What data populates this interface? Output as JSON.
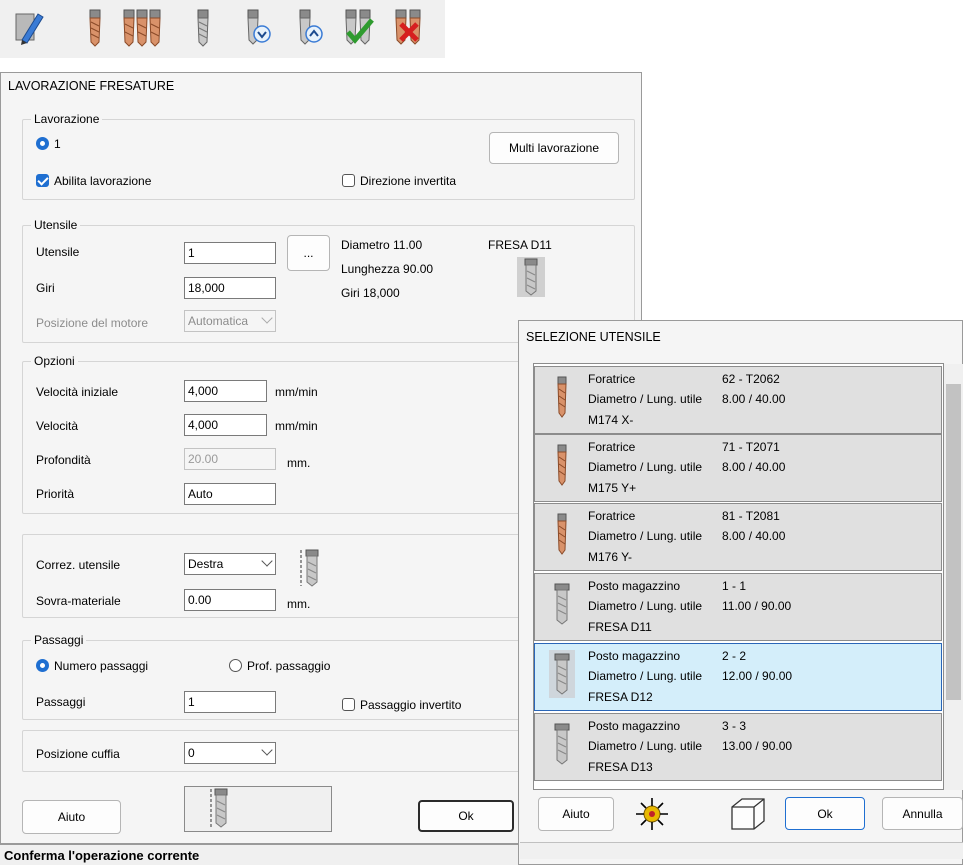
{
  "toolbar": {
    "buttons": [
      {
        "icon": "edit-pencil-icon"
      },
      {
        "icon": "tool-single-icon"
      },
      {
        "icon": "tool-multiple-icon"
      },
      {
        "icon": "tool-gray-icon"
      },
      {
        "icon": "tool-move-down-icon"
      },
      {
        "icon": "tool-move-up-icon"
      },
      {
        "icon": "tool-confirm-icon"
      },
      {
        "icon": "tool-delete-icon"
      }
    ]
  },
  "main": {
    "title": "LAVORAZIONE FRESATURE",
    "lavorazione": {
      "group_label": "Lavorazione",
      "radio_label": "1",
      "multi_button": "Multi lavorazione",
      "enable_label": "Abilita lavorazione",
      "enable_checked": true,
      "invert_dir_label": "Direzione invertita",
      "invert_dir_checked": false
    },
    "utensile": {
      "group_label": "Utensile",
      "tool_label": "Utensile",
      "tool_value": "1",
      "browse_label": "...",
      "giri_label": "Giri",
      "giri_value": "18,000",
      "motor_label": "Posizione del motore",
      "motor_value": "Automatica",
      "info_diam": "Diametro  11.00",
      "info_len": "Lunghezza  90.00",
      "info_giri": "Giri  18,000",
      "tool_name": "FRESA D11"
    },
    "opzioni": {
      "group_label": "Opzioni",
      "vel_init_label": "Velocità iniziale",
      "vel_init_value": "4,000",
      "vel_init_unit": "mm/min",
      "vel_label": "Velocità",
      "vel_value": "4,000",
      "vel_unit": "mm/min",
      "prof_label": "Profondità",
      "prof_value": "20.00",
      "prof_unit": "mm.",
      "prio_label": "Priorità",
      "prio_value": "Auto"
    },
    "correz": {
      "label": "Correz. utensile",
      "value": "Destra",
      "sovra_label": "Sovra-materiale",
      "sovra_value": "0.00",
      "sovra_unit": "mm."
    },
    "passaggi": {
      "group_label": "Passaggi",
      "num_label": "Numero passaggi",
      "num_checked": true,
      "prof_label": "Prof. passaggio",
      "prof_checked": false,
      "pass_label": "Passaggi",
      "pass_value": "1",
      "invert_label": "Passaggio invertito",
      "invert_checked": false
    },
    "cuffia": {
      "label": "Posizione cuffia",
      "value": "0"
    },
    "help_button": "Aiuto",
    "ok_button": "Ok"
  },
  "status_bar": "Conferma l'operazione corrente",
  "selector": {
    "title": "SELEZIONE UTENSILE",
    "items": [
      {
        "type": "Foratrice",
        "code": "62 - T2062",
        "dim_label": "Diametro / Lung. utile",
        "dims": "8.00 / 40.00",
        "desc": "M174 X-",
        "selected": false,
        "icon": "drill-bit-icon"
      },
      {
        "type": "Foratrice",
        "code": "71 - T2071",
        "dim_label": "Diametro / Lung. utile",
        "dims": "8.00 / 40.00",
        "desc": "M175 Y+",
        "selected": false,
        "icon": "drill-bit-icon"
      },
      {
        "type": "Foratrice",
        "code": "81 - T2081",
        "dim_label": "Diametro / Lung. utile",
        "dims": "8.00 / 40.00",
        "desc": "M176 Y-",
        "selected": false,
        "icon": "drill-bit-icon"
      },
      {
        "type": "Posto magazzino",
        "code": "1 - 1",
        "dim_label": "Diametro / Lung. utile",
        "dims": "11.00 / 90.00",
        "desc": "FRESA D11",
        "selected": false,
        "icon": "router-bit-icon"
      },
      {
        "type": "Posto magazzino",
        "code": "2 - 2",
        "dim_label": "Diametro / Lung. utile",
        "dims": "12.00 / 90.00",
        "desc": "FRESA D12",
        "selected": true,
        "icon": "router-bit-icon"
      },
      {
        "type": "Posto magazzino",
        "code": "3 - 3",
        "dim_label": "Diametro / Lung. utile",
        "dims": "13.00 / 90.00",
        "desc": "FRESA D13",
        "selected": false,
        "icon": "router-bit-icon"
      }
    ],
    "help_button": "Aiuto",
    "ok_button": "Ok",
    "cancel_button": "Annulla"
  },
  "colors": {
    "accent": "#1f6fd1",
    "selected_bg": "#d4eefa",
    "item_bg": "#e0e0e0"
  }
}
